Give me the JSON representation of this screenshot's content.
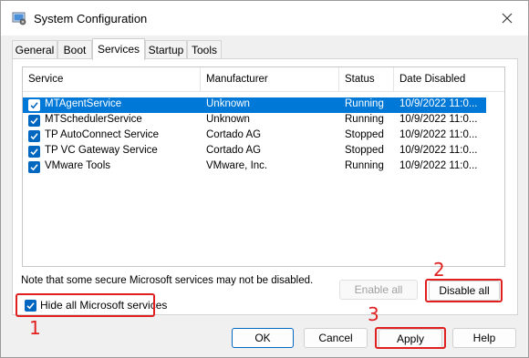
{
  "window": {
    "title": "System Configuration"
  },
  "tabs": [
    {
      "label": "General"
    },
    {
      "label": "Boot"
    },
    {
      "label": "Services"
    },
    {
      "label": "Startup"
    },
    {
      "label": "Tools"
    }
  ],
  "active_tab": "Services",
  "columns": [
    "Service",
    "Manufacturer",
    "Status",
    "Date Disabled"
  ],
  "services": [
    {
      "name": "MTAgentService",
      "manufacturer": "Unknown",
      "status": "Running",
      "date": "10/9/2022 11:0...",
      "checked": true,
      "selected": true
    },
    {
      "name": "MTSchedulerService",
      "manufacturer": "Unknown",
      "status": "Running",
      "date": "10/9/2022 11:0...",
      "checked": true,
      "selected": false
    },
    {
      "name": "TP AutoConnect Service",
      "manufacturer": "Cortado AG",
      "status": "Stopped",
      "date": "10/9/2022 11:0...",
      "checked": true,
      "selected": false
    },
    {
      "name": "TP VC Gateway Service",
      "manufacturer": "Cortado AG",
      "status": "Stopped",
      "date": "10/9/2022 11:0...",
      "checked": true,
      "selected": false
    },
    {
      "name": "VMware Tools",
      "manufacturer": "VMware, Inc.",
      "status": "Running",
      "date": "10/9/2022 11:0...",
      "checked": true,
      "selected": false
    }
  ],
  "note": "Note that some secure Microsoft services may not be disabled.",
  "buttons": {
    "enable_all": "Enable all",
    "disable_all": "Disable all",
    "ok": "OK",
    "cancel": "Cancel",
    "apply": "Apply",
    "help": "Help"
  },
  "hide_ms": {
    "label": "Hide all Microsoft services",
    "checked": true
  },
  "annotations": {
    "step1": "1",
    "step2": "2",
    "step3": "3"
  },
  "colors": {
    "accent": "#0067c0",
    "selection": "#0078d7",
    "annotation": "#e02020"
  }
}
